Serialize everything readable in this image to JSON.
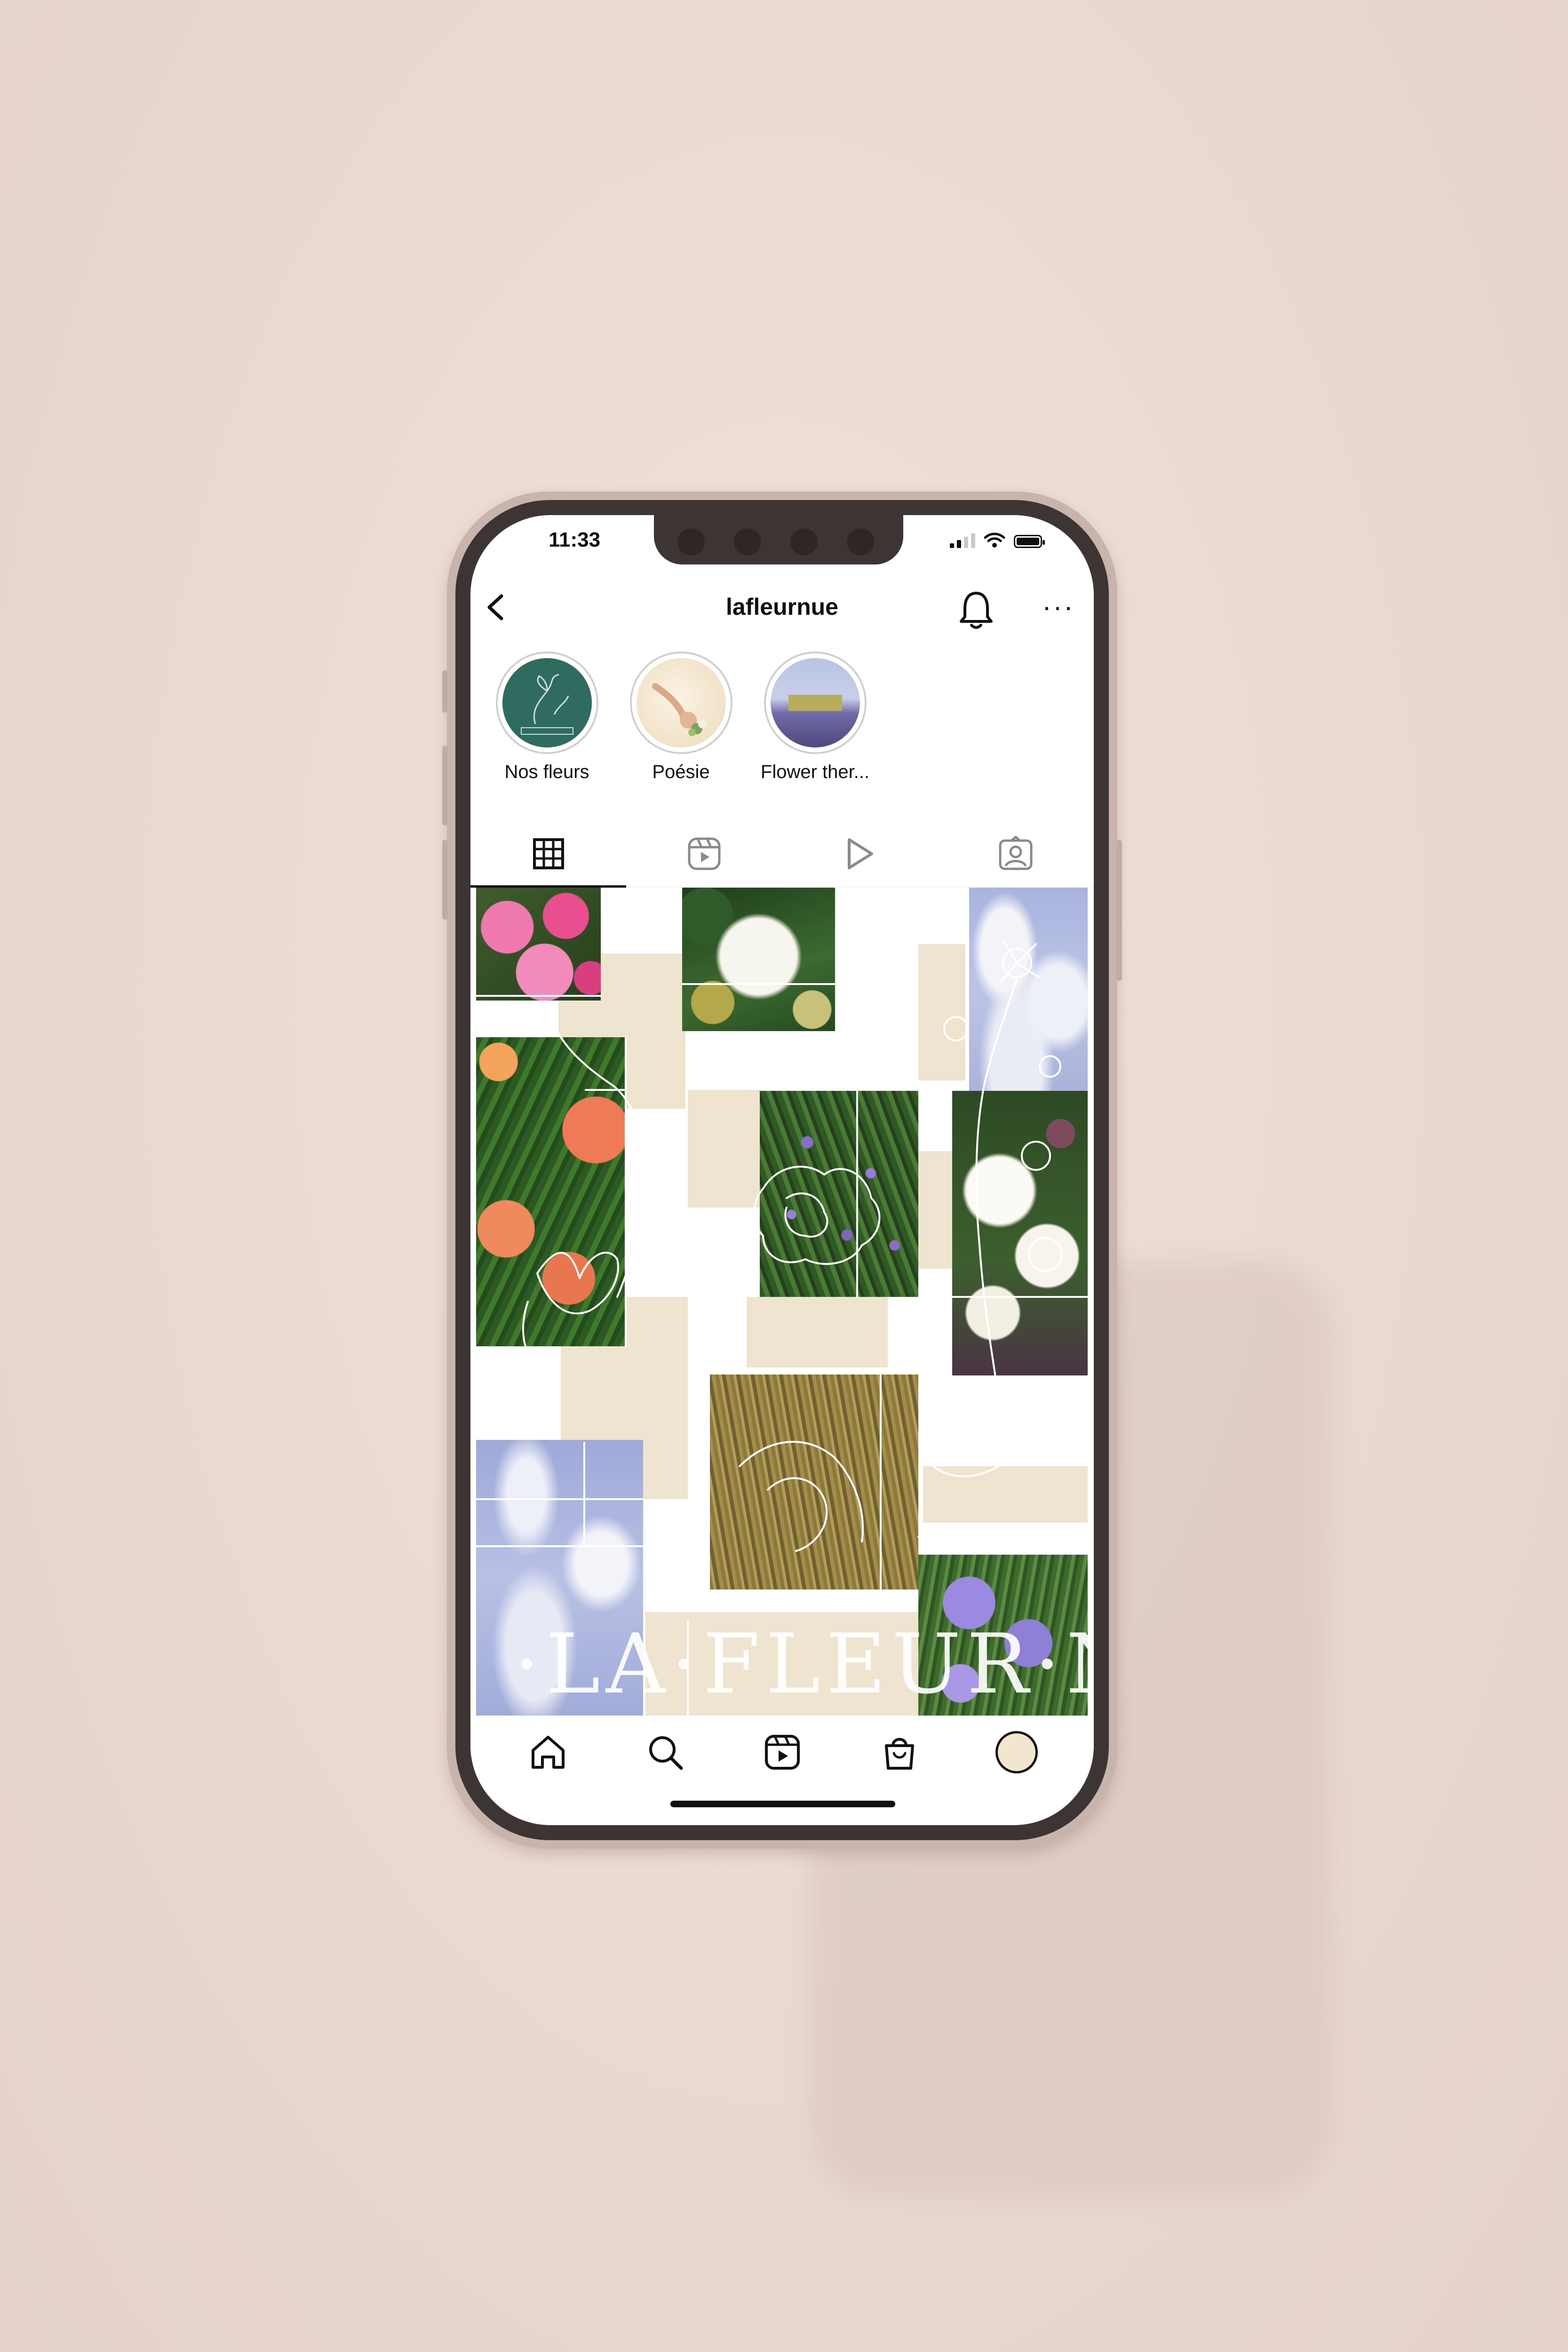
{
  "status": {
    "time": "11:33"
  },
  "header": {
    "username": "lafleurnue"
  },
  "highlights": [
    {
      "label": "Nos fleurs",
      "ring_color": "#d0d0d0",
      "fill": "#2f6b5e"
    },
    {
      "label": "Poésie",
      "ring_color": "#d0d0d0",
      "fill": "#f2e6cd"
    },
    {
      "label": "Flower ther...",
      "ring_color": "#d0d0d0",
      "fill": "#8f8fc4"
    }
  ],
  "tabs": [
    {
      "icon": "grid-icon",
      "active": true
    },
    {
      "icon": "reels-icon",
      "active": false
    },
    {
      "icon": "play-icon",
      "active": false
    },
    {
      "icon": "tagged-icon",
      "active": false
    }
  ],
  "feed": {
    "brand_text": "·LA·FLEUR·NUE·"
  },
  "bottom_nav": [
    "home-icon",
    "search-icon",
    "reels-icon",
    "shop-icon",
    "profile-avatar"
  ],
  "colors": {
    "background": "#ecdad3",
    "phone_frame": "#c8b4ac",
    "beige_tile": "#efe4cf",
    "text": "#111111"
  }
}
